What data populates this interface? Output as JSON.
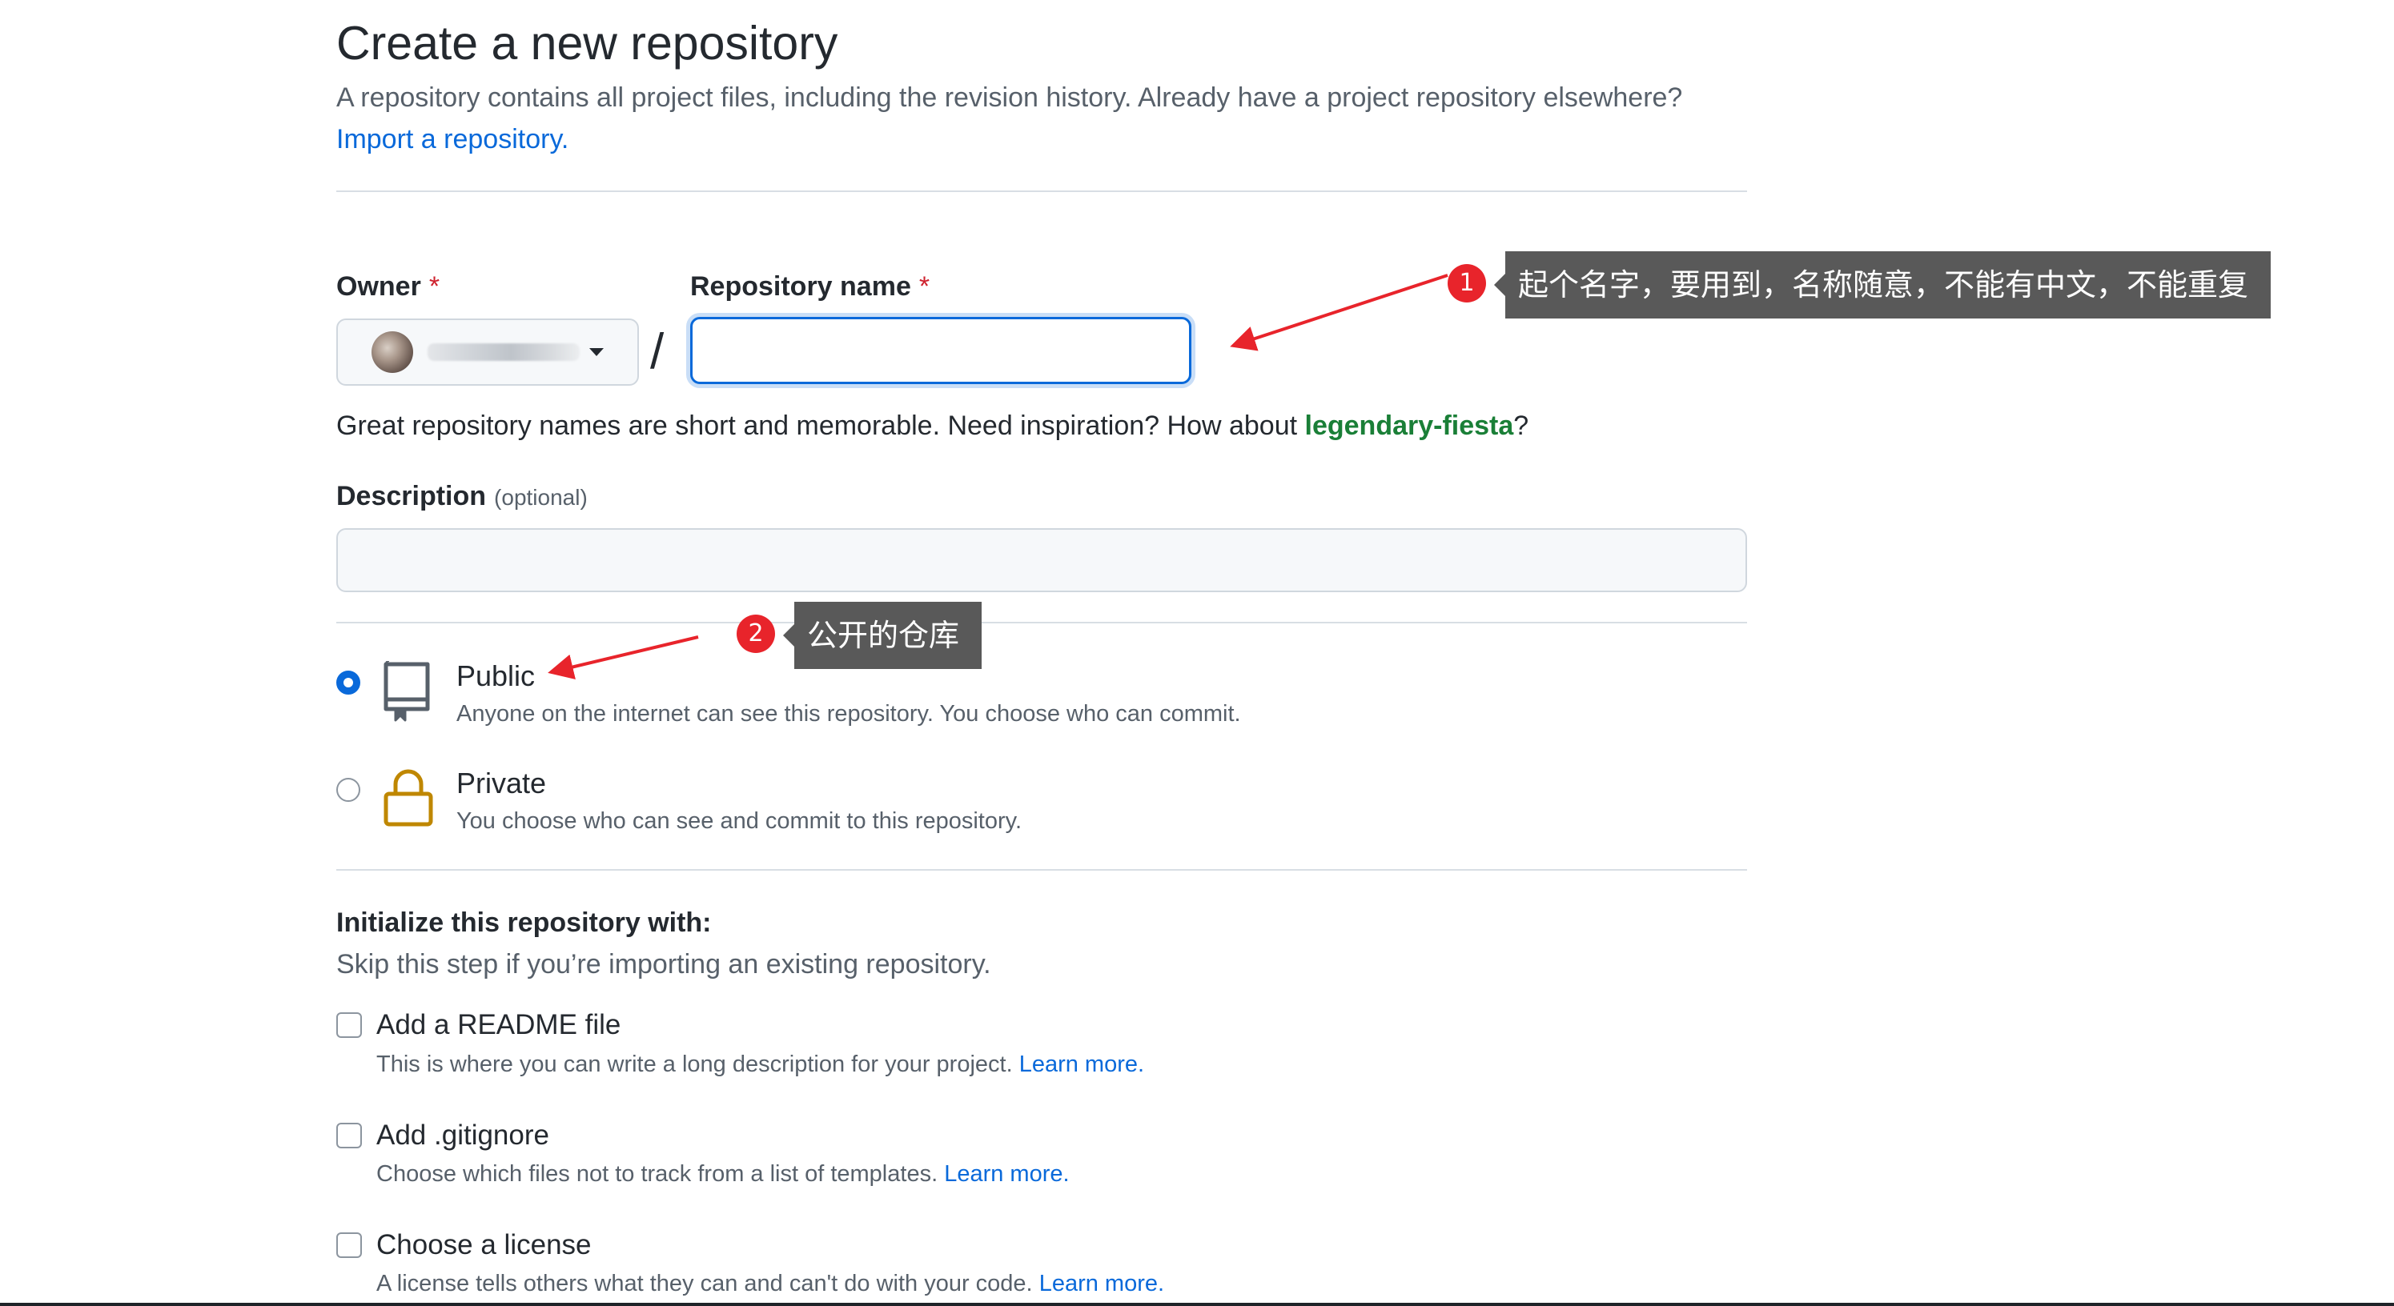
{
  "header": {
    "title": "Create a new repository",
    "subtitle": "A repository contains all project files, including the revision history. Already have a project repository elsewhere?",
    "import_link": "Import a repository."
  },
  "owner": {
    "label": "Owner",
    "required_mark": "*"
  },
  "repo_name": {
    "label": "Repository name",
    "required_mark": "*",
    "value": "",
    "slash": "/"
  },
  "hint": {
    "prefix": "Great repository names are short and memorable. Need inspiration? How about ",
    "suggestion": "legendary-fiesta",
    "suffix": "?"
  },
  "description": {
    "label": "Description",
    "optional": "(optional)",
    "value": ""
  },
  "visibility": {
    "selected": "public",
    "options": [
      {
        "id": "public",
        "title": "Public",
        "description": "Anyone on the internet can see this repository. You choose who can commit.",
        "icon": "repo-icon"
      },
      {
        "id": "private",
        "title": "Private",
        "description": "You choose who can see and commit to this repository.",
        "icon": "lock-icon"
      }
    ]
  },
  "initialize": {
    "heading": "Initialize this repository with:",
    "subheading": "Skip this step if you’re importing an existing repository.",
    "options": [
      {
        "title": "Add a README file",
        "description": "This is where you can write a long description for your project. ",
        "learn_more": "Learn more.",
        "checked": false
      },
      {
        "title": "Add .gitignore",
        "description": "Choose which files not to track from a list of templates. ",
        "learn_more": "Learn more.",
        "checked": false
      },
      {
        "title": "Choose a license",
        "description": "A license tells others what they can and can't do with your code. ",
        "learn_more": "Learn more.",
        "checked": false
      }
    ]
  },
  "annotations": [
    {
      "number": "1",
      "text": "起个名字，要用到，名称随意，不能有中文，不能重复"
    },
    {
      "number": "2",
      "text": "公开的仓库"
    }
  ],
  "colors": {
    "link": "#0969da",
    "suggestion": "#1a7f37",
    "required": "#cf222e",
    "focus": "#0969da",
    "annotation_badge": "#e8242b",
    "annotation_box": "#595959",
    "lock_icon": "#bf8700"
  }
}
